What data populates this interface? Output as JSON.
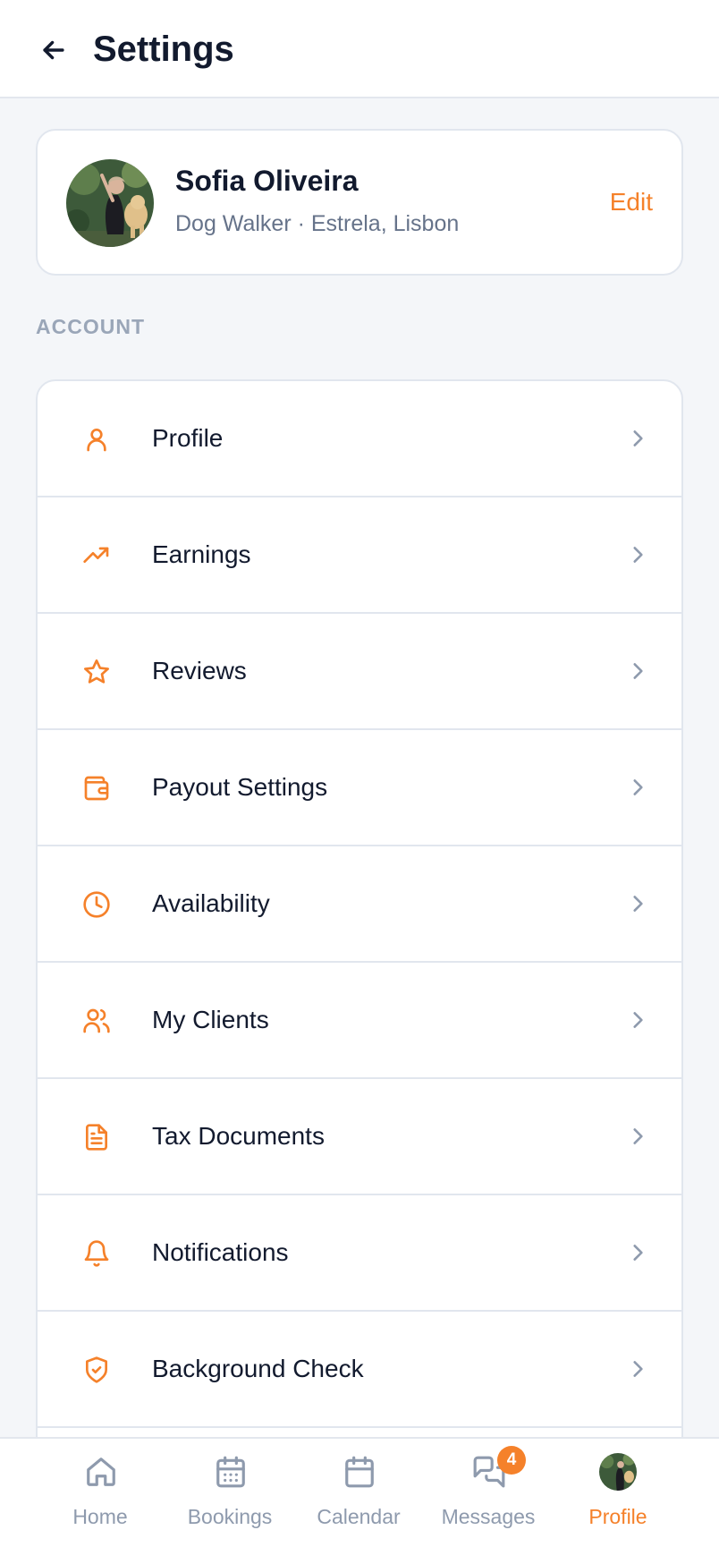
{
  "header": {
    "title": "Settings"
  },
  "profile": {
    "name": "Sofia Oliveira",
    "subtitle": "Dog Walker · Estrela, Lisbon",
    "edit_label": "Edit"
  },
  "account": {
    "section_title": "ACCOUNT",
    "items": [
      {
        "label": "Profile",
        "icon": "user-icon"
      },
      {
        "label": "Earnings",
        "icon": "trending-up-icon"
      },
      {
        "label": "Reviews",
        "icon": "star-icon"
      },
      {
        "label": "Payout Settings",
        "icon": "wallet-icon"
      },
      {
        "label": "Availability",
        "icon": "clock-icon"
      },
      {
        "label": "My Clients",
        "icon": "users-icon"
      },
      {
        "label": "Tax Documents",
        "icon": "document-icon"
      },
      {
        "label": "Notifications",
        "icon": "bell-icon"
      },
      {
        "label": "Background Check",
        "icon": "shield-check-icon"
      }
    ]
  },
  "tabbar": {
    "items": [
      {
        "label": "Home",
        "icon": "home-icon"
      },
      {
        "label": "Bookings",
        "icon": "bookings-calendar-icon"
      },
      {
        "label": "Calendar",
        "icon": "calendar-icon"
      },
      {
        "label": "Messages",
        "icon": "chat-icon",
        "badge": "4"
      },
      {
        "label": "Profile",
        "icon": "avatar",
        "active": true
      }
    ]
  },
  "colors": {
    "accent": "#f5812a",
    "text": "#121a2e",
    "muted": "#66738a",
    "background": "#f4f6f9"
  }
}
